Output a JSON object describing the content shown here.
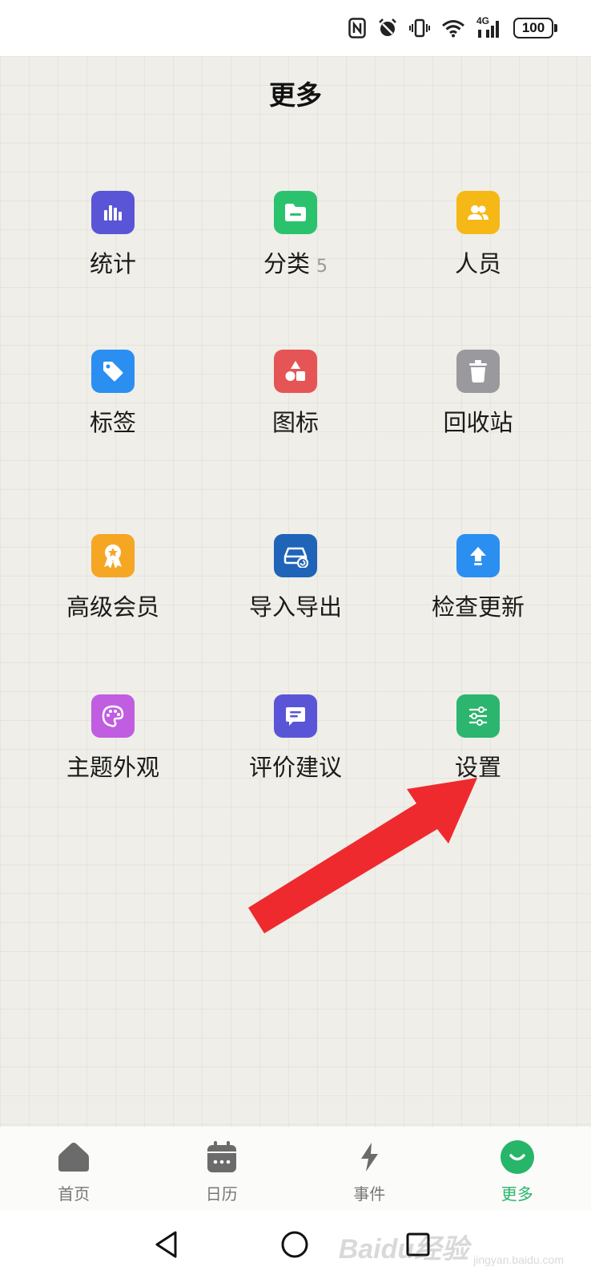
{
  "status_bar": {
    "battery_level": "100",
    "network_label": "4G",
    "icons": [
      "nfc-icon",
      "alarm-icon",
      "vibrate-icon",
      "wifi-icon",
      "signal-icon",
      "battery-icon"
    ]
  },
  "header": {
    "title": "更多"
  },
  "grid": {
    "items": [
      {
        "label": "统计",
        "icon": "stats-icon",
        "color": "#5a55d6"
      },
      {
        "label": "分类",
        "badge": "5",
        "icon": "folder-icon",
        "color": "#2bc26e"
      },
      {
        "label": "人员",
        "icon": "people-icon",
        "color": "#f6b817"
      },
      {
        "label": "标签",
        "icon": "tag-icon",
        "color": "#2a8ff0"
      },
      {
        "label": "图标",
        "icon": "shapes-icon",
        "color": "#e65556"
      },
      {
        "label": "回收站",
        "icon": "trash-icon",
        "color": "#9a9a9e"
      },
      {
        "label": "高级会员",
        "icon": "award-icon",
        "color": "#f5a623"
      },
      {
        "label": "导入导出",
        "icon": "import-export-icon",
        "color": "#1f64b8"
      },
      {
        "label": "检查更新",
        "icon": "upgrade-icon",
        "color": "#2a8ff0"
      },
      {
        "label": "主题外观",
        "icon": "palette-icon",
        "color": "#c05de0"
      },
      {
        "label": "评价建议",
        "icon": "feedback-icon",
        "color": "#5a55d6"
      },
      {
        "label": "设置",
        "icon": "sliders-icon",
        "color": "#2bb56e"
      }
    ]
  },
  "annotation": {
    "arrow_color": "#ee2a2f"
  },
  "tab_bar": {
    "tabs": [
      {
        "label": "首页",
        "icon": "home-icon"
      },
      {
        "label": "日历",
        "icon": "calendar-icon"
      },
      {
        "label": "事件",
        "icon": "lightning-icon"
      },
      {
        "label": "更多",
        "icon": "more-smile-icon",
        "active": true
      }
    ],
    "active_color": "#27b56a",
    "inactive_color": "#777777"
  },
  "system_nav": {
    "buttons": [
      "back-icon",
      "home-circle-icon",
      "recents-icon"
    ]
  },
  "watermark": {
    "main": "Baidu经验",
    "sub": "jingyan.baidu.com"
  }
}
